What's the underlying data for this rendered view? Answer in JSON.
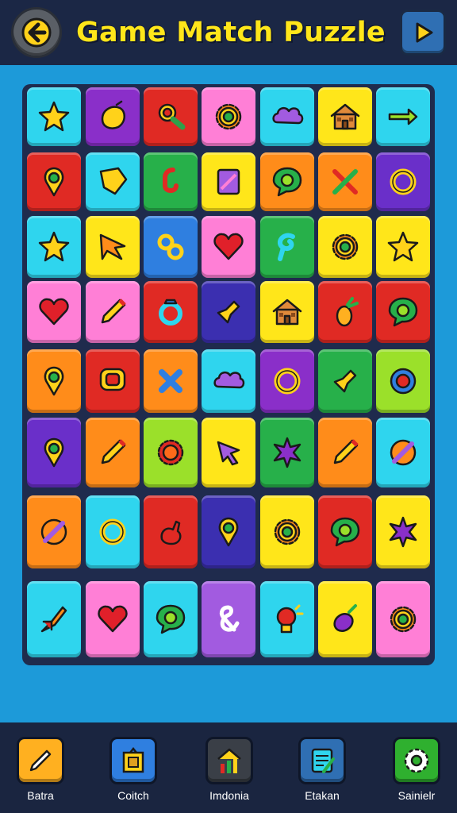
{
  "header": {
    "title": "Game Match Puzzle",
    "back_icon": "back-arrow-icon",
    "play_icon": "play-icon"
  },
  "colors": {
    "header_bg": "#1b2745",
    "play_area_bg": "#1d9ad9",
    "board_bg": "#1f2b4d",
    "title": "#ffe61a"
  },
  "board": {
    "rows": 8,
    "cols": 7,
    "tiles": [
      [
        {
          "bg": "#2fd5ee",
          "icon": "star"
        },
        {
          "bg": "#8a2fc9",
          "icon": "lemon"
        },
        {
          "bg": "#e02a24",
          "icon": "magnifier"
        },
        {
          "bg": "#ff7fd6",
          "icon": "gear"
        },
        {
          "bg": "#2fd5ee",
          "icon": "cloud"
        },
        {
          "bg": "#ffe61a",
          "icon": "house"
        },
        {
          "bg": "#2fd5ee",
          "icon": "arrow"
        }
      ],
      [
        {
          "bg": "#e02a24",
          "icon": "pin"
        },
        {
          "bg": "#2fd5ee",
          "icon": "shield"
        },
        {
          "bg": "#27b04a",
          "icon": "hook"
        },
        {
          "bg": "#ffe61a",
          "icon": "book"
        },
        {
          "bg": "#ff8c1a",
          "icon": "bubble"
        },
        {
          "bg": "#ff8c1a",
          "icon": "cross-tools"
        },
        {
          "bg": "#6a2fc9",
          "icon": "ring"
        }
      ],
      [
        {
          "bg": "#2fd5ee",
          "icon": "star"
        },
        {
          "bg": "#ffe61a",
          "icon": "flag"
        },
        {
          "bg": "#2f7fe0",
          "icon": "link"
        },
        {
          "bg": "#ff7fd6",
          "icon": "heart"
        },
        {
          "bg": "#27b04a",
          "icon": "swirl"
        },
        {
          "bg": "#ffe61a",
          "icon": "gear"
        },
        {
          "bg": "#ffe61a",
          "icon": "star"
        }
      ],
      [
        {
          "bg": "#ff7fd6",
          "icon": "heart"
        },
        {
          "bg": "#ff7fd6",
          "icon": "pencil"
        },
        {
          "bg": "#e02a24",
          "icon": "ring-gem"
        },
        {
          "bg": "#3b2fb0",
          "icon": "arrow-diag"
        },
        {
          "bg": "#ffe61a",
          "icon": "house"
        },
        {
          "bg": "#e02a24",
          "icon": "pineapple"
        },
        {
          "bg": "#e02a24",
          "icon": "bubble"
        }
      ],
      [
        {
          "bg": "#ff8c1a",
          "icon": "pin"
        },
        {
          "bg": "#e02a24",
          "icon": "bubble-sq"
        },
        {
          "bg": "#ff8c1a",
          "icon": "cross"
        },
        {
          "bg": "#2fd5ee",
          "icon": "cloud"
        },
        {
          "bg": "#8a2fc9",
          "icon": "ring"
        },
        {
          "bg": "#27b04a",
          "icon": "arrow-diag"
        },
        {
          "bg": "#9be02a",
          "icon": "target"
        }
      ],
      [
        {
          "bg": "#6a2fc9",
          "icon": "pin"
        },
        {
          "bg": "#ff8c1a",
          "icon": "pencil"
        },
        {
          "bg": "#9be02a",
          "icon": "sun"
        },
        {
          "bg": "#ffe61a",
          "icon": "cursor"
        },
        {
          "bg": "#27b04a",
          "icon": "splat"
        },
        {
          "bg": "#ff8c1a",
          "icon": "pencil"
        },
        {
          "bg": "#2fd5ee",
          "icon": "no-pencil"
        }
      ],
      [
        {
          "bg": "#ff8c1a",
          "icon": "no-pencil"
        },
        {
          "bg": "#2fd5ee",
          "icon": "ring"
        },
        {
          "bg": "#e02a24",
          "icon": "rabbit"
        },
        {
          "bg": "#3b2fb0",
          "icon": "pin"
        },
        {
          "bg": "#ffe61a",
          "icon": "gear"
        },
        {
          "bg": "#e02a24",
          "icon": "bubble"
        },
        {
          "bg": "#ffe61a",
          "icon": "splat"
        }
      ],
      [
        {
          "bg": "#2fd5ee",
          "icon": "rocket"
        },
        {
          "bg": "#ff7fd6",
          "icon": "heart"
        },
        {
          "bg": "#2fd5ee",
          "icon": "bubble"
        },
        {
          "bg": "#a25be0",
          "icon": "ampersand"
        },
        {
          "bg": "#2fd5ee",
          "icon": "bulb"
        },
        {
          "bg": "#ffe61a",
          "icon": "eggplant"
        },
        {
          "bg": "#ff7fd6",
          "icon": "gear"
        }
      ]
    ]
  },
  "bottom_nav": [
    {
      "label": "Batra",
      "icon": "pen-icon",
      "bg": "#ffb020"
    },
    {
      "label": "Coitch",
      "icon": "frame-icon",
      "bg": "#2f7fe0"
    },
    {
      "label": "Imdonia",
      "icon": "chart-house-icon",
      "bg": "#3a3f47"
    },
    {
      "label": "Etakan",
      "icon": "notepad-icon",
      "bg": "#2f6fb3"
    },
    {
      "label": "Sainielr",
      "icon": "settings-gear-icon",
      "bg": "#2fb02f"
    }
  ]
}
